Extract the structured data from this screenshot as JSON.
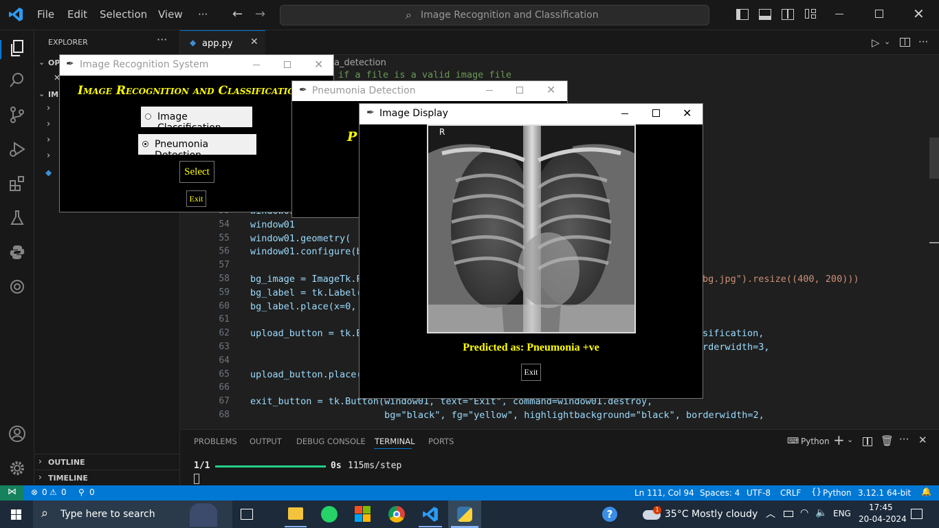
{
  "titlebar": {
    "menus": [
      "File",
      "Edit",
      "Selection",
      "View",
      "···"
    ],
    "search": "Image Recognition and Classification"
  },
  "sidebar": {
    "title": "EXPLORER",
    "open_editors": "OP",
    "folder": "IM",
    "outline": "OUTLINE",
    "timeline": "TIMELINE"
  },
  "tab": {
    "filename": "app.py"
  },
  "breadcrumb": "a_detection",
  "code_comment": "if a file is a valid image file",
  "code_lines": [
    {
      "num": "53",
      "text": "window01"
    },
    {
      "num": "54",
      "text": "window01"
    },
    {
      "num": "55",
      "text": "window01.geometry("
    },
    {
      "num": "56",
      "text": "window01.configure(b"
    },
    {
      "num": "57",
      "text": ""
    },
    {
      "num": "58",
      "text": "bg_image = ImageTk.P"
    },
    {
      "num": "59",
      "text": "bg_label = tk.Label("
    },
    {
      "num": "60",
      "text": "bg_label.place(x=0, "
    },
    {
      "num": "61",
      "text": ""
    },
    {
      "num": "62",
      "text": "upload_button = tk.B"
    },
    {
      "num": "63",
      "text": ""
    },
    {
      "num": "64",
      "text": ""
    },
    {
      "num": "65",
      "text": "upload_button.place("
    },
    {
      "num": "66",
      "text": ""
    },
    {
      "num": "67",
      "text": "exit_button = tk.Button(window01, text=\"Exit\", command=window01.destroy,"
    },
    {
      "num": "68",
      "text": "                        bg=\"black\", fg=\"yellow\", highlightbackground=\"black\", borderwidth=2,"
    }
  ],
  "code_right": {
    "line58": "bg.jpg\").resize((400, 200)))",
    "line62": "sification,",
    "line63": "rderwidth=3,"
  },
  "panel": {
    "tabs": [
      "PROBLEMS",
      "OUTPUT",
      "DEBUG CONSOLE",
      "TERMINAL",
      "PORTS"
    ],
    "shell": "Python",
    "progress_label": "1/1",
    "progress_time": "0s",
    "progress_rate": "115ms/step",
    "progress_fraction": 1.0
  },
  "status": {
    "errors": "0",
    "warnings": "0",
    "ports": "0",
    "position": "Ln 111, Col 94",
    "spaces": "Spaces: 4",
    "encoding": "UTF-8",
    "eol": "CRLF",
    "language": "Python",
    "interpreter": "3.12.1 64-bit"
  },
  "taskbar": {
    "search": "Type here to search",
    "weather_temp": "35°C",
    "weather_desc": "Mostly cloudy",
    "lang": "ENG",
    "time": "17:45",
    "date": "20-04-2024",
    "weather_badge": "1"
  },
  "win_main": {
    "title": "Image Recognition System",
    "heading": "Image Recognition and Classification",
    "option1": "Image Classification",
    "option2": "Pneumonia Detection",
    "select": "Select",
    "exit": "Exit"
  },
  "win_pneu": {
    "title": "Pneumonia Detection",
    "heading_fragment": "P"
  },
  "win_display": {
    "title": "Image Display",
    "xray_marker": "R",
    "prediction": "Predicted as: Pneumonia +ve",
    "exit": "Exit"
  },
  "colors": {
    "accent": "#0078d4",
    "tk_yellow": "#ffff00",
    "tk_bg": "#000000"
  }
}
